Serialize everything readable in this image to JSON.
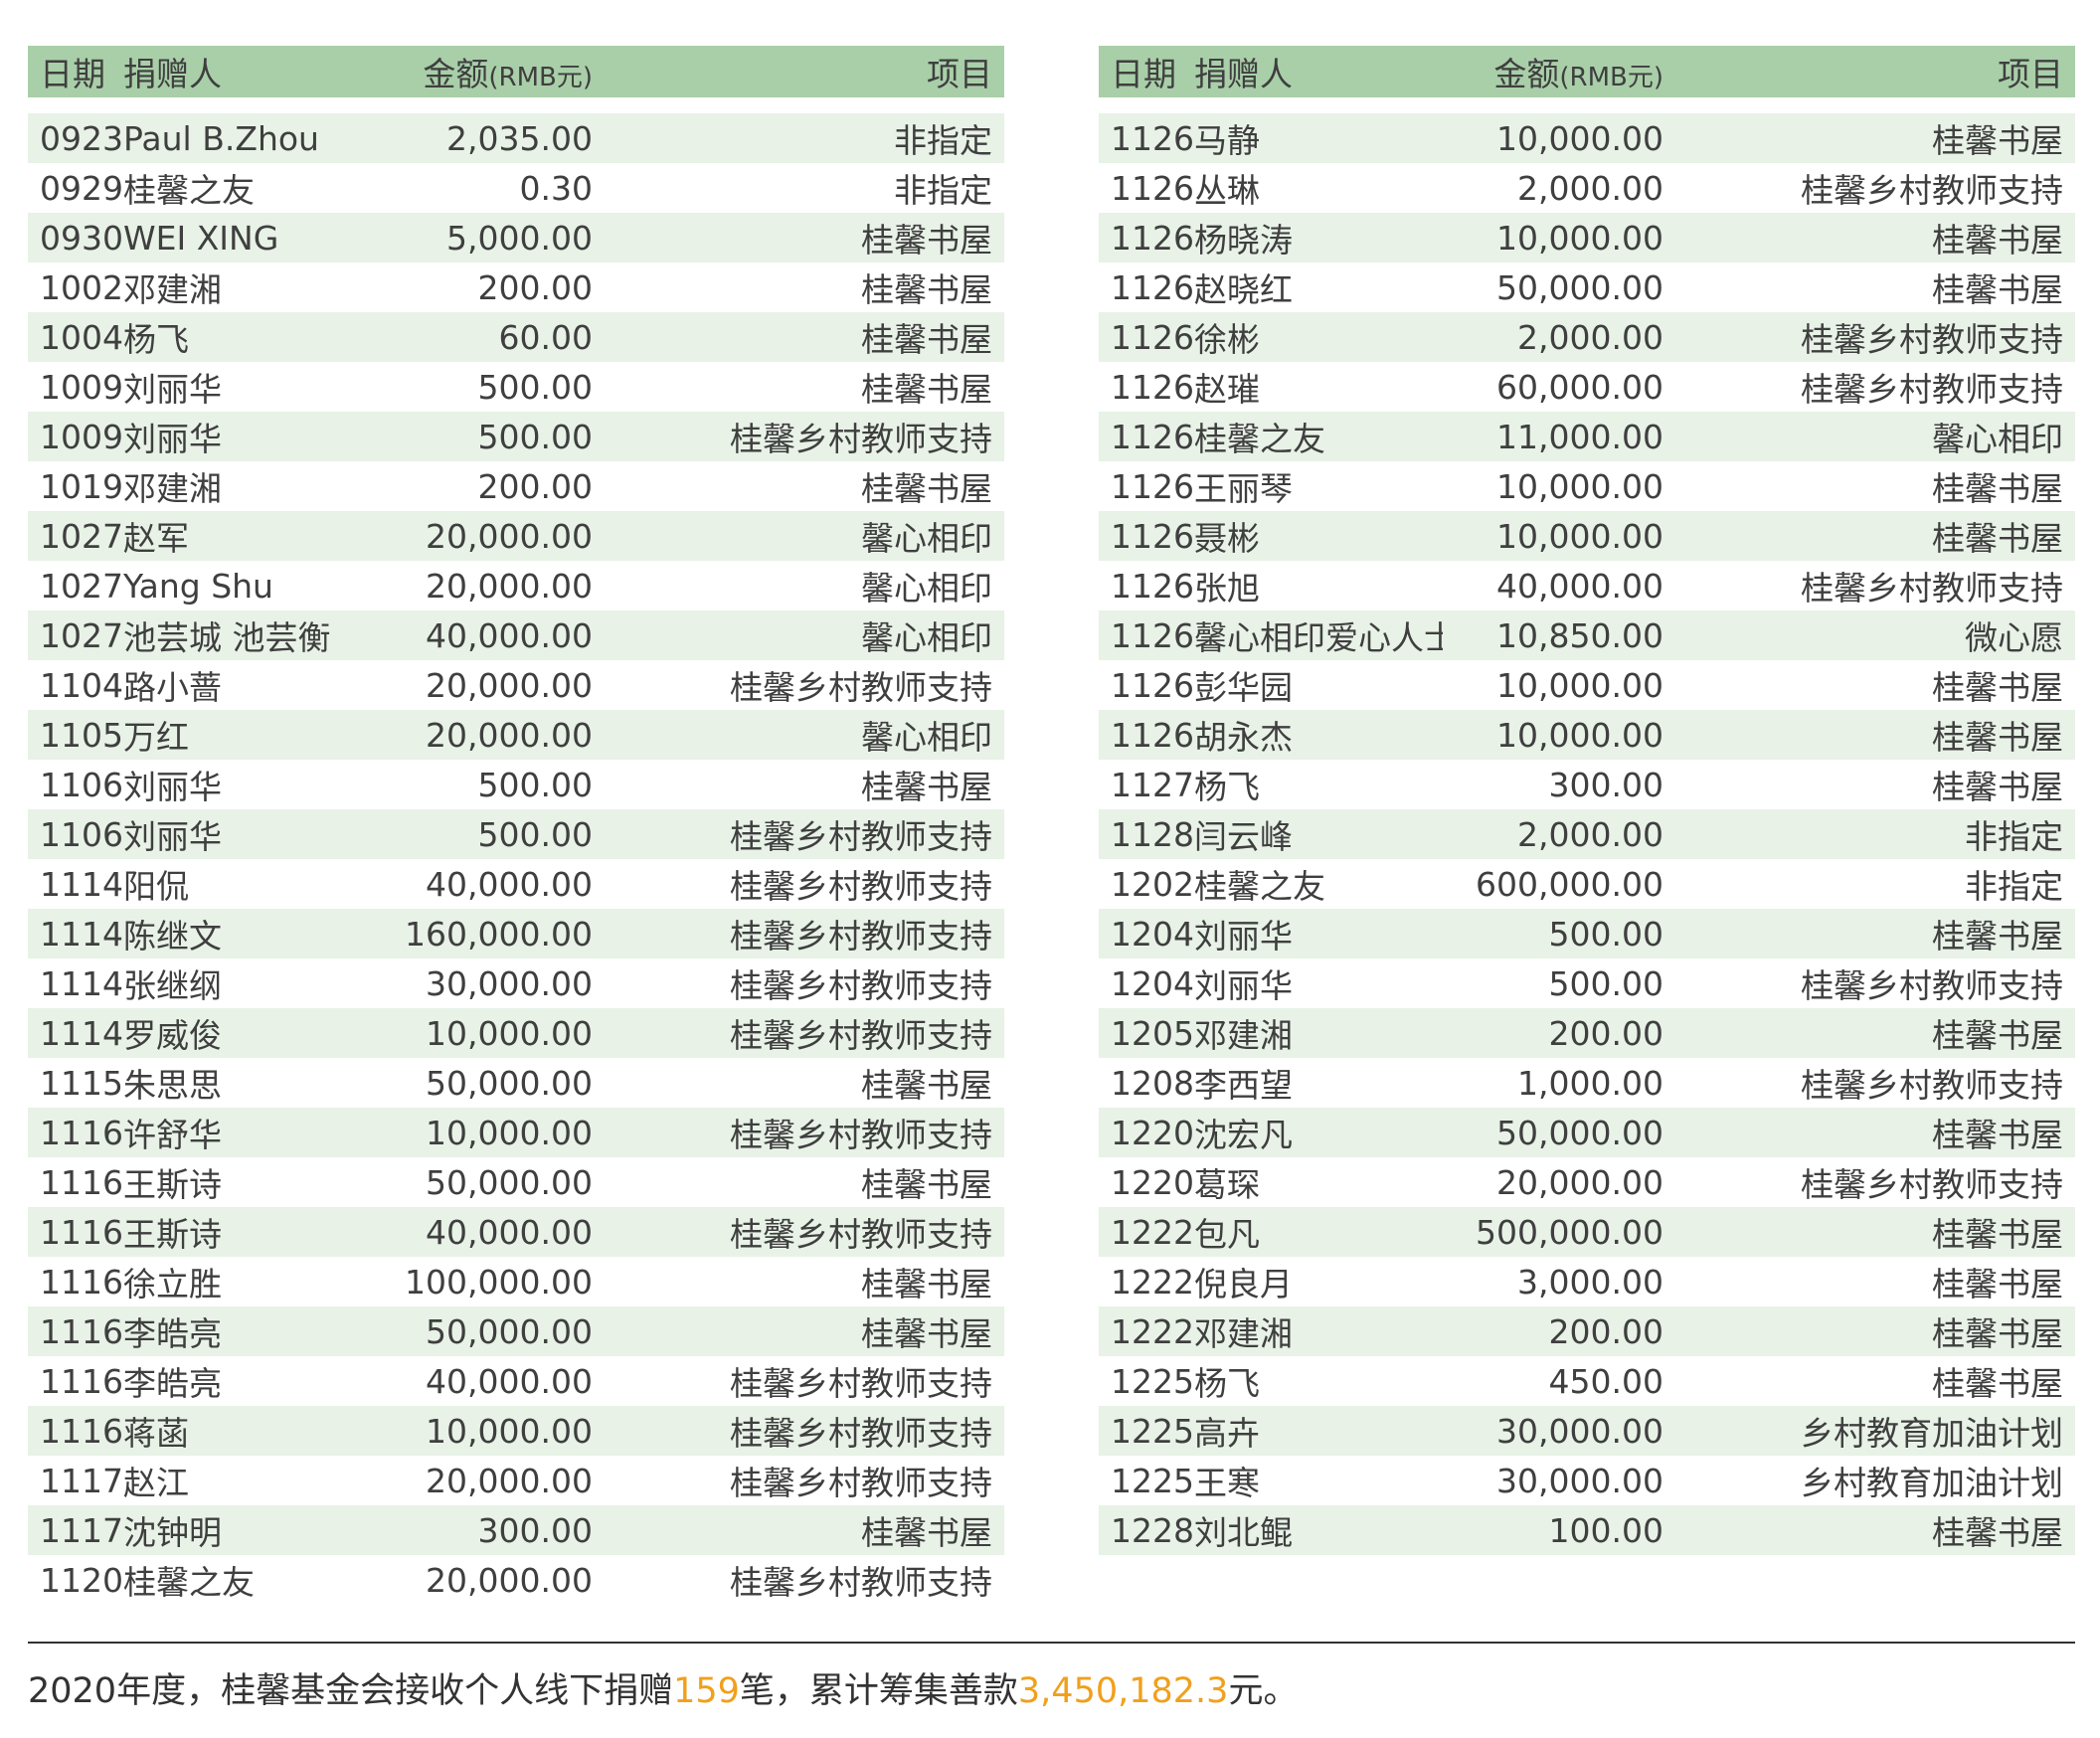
{
  "headers": {
    "date": "日期",
    "donor": "捐赠人",
    "amount": "金额",
    "amount_unit": "(RMB元)",
    "project": "项目"
  },
  "left_rows": [
    {
      "date": "0923",
      "donor": "Paul B.Zhou",
      "amount": "2,035.00",
      "project": "非指定"
    },
    {
      "date": "0929",
      "donor": "桂馨之友",
      "amount": "0.30",
      "project": "非指定"
    },
    {
      "date": "0930",
      "donor": "WEI XING",
      "amount": "5,000.00",
      "project": "桂馨书屋"
    },
    {
      "date": "1002",
      "donor": "邓建湘",
      "amount": "200.00",
      "project": "桂馨书屋"
    },
    {
      "date": "1004",
      "donor": "杨飞",
      "amount": "60.00",
      "project": "桂馨书屋"
    },
    {
      "date": "1009",
      "donor": "刘丽华",
      "amount": "500.00",
      "project": "桂馨书屋"
    },
    {
      "date": "1009",
      "donor": "刘丽华",
      "amount": "500.00",
      "project": "桂馨乡村教师支持"
    },
    {
      "date": "1019",
      "donor": "邓建湘",
      "amount": "200.00",
      "project": "桂馨书屋"
    },
    {
      "date": "1027",
      "donor": "赵军",
      "amount": "20,000.00",
      "project": "馨心相印"
    },
    {
      "date": "1027",
      "donor": "Yang Shu",
      "amount": "20,000.00",
      "project": "馨心相印"
    },
    {
      "date": "1027",
      "donor": "池芸城 池芸衡",
      "amount": "40,000.00",
      "project": "馨心相印"
    },
    {
      "date": "1104",
      "donor": "路小蔷",
      "amount": "20,000.00",
      "project": "桂馨乡村教师支持"
    },
    {
      "date": "1105",
      "donor": "万红",
      "amount": "20,000.00",
      "project": "馨心相印"
    },
    {
      "date": "1106",
      "donor": "刘丽华",
      "amount": "500.00",
      "project": "桂馨书屋"
    },
    {
      "date": "1106",
      "donor": "刘丽华",
      "amount": "500.00",
      "project": "桂馨乡村教师支持"
    },
    {
      "date": "1114",
      "donor": "阳侃",
      "amount": "40,000.00",
      "project": "桂馨乡村教师支持"
    },
    {
      "date": "1114",
      "donor": "陈继文",
      "amount": "160,000.00",
      "project": "桂馨乡村教师支持"
    },
    {
      "date": "1114",
      "donor": "张继纲",
      "amount": "30,000.00",
      "project": "桂馨乡村教师支持"
    },
    {
      "date": "1114",
      "donor": "罗威俊",
      "amount": "10,000.00",
      "project": "桂馨乡村教师支持"
    },
    {
      "date": "1115",
      "donor": "朱思思",
      "amount": "50,000.00",
      "project": "桂馨书屋"
    },
    {
      "date": "1116",
      "donor": "许舒华",
      "amount": "10,000.00",
      "project": "桂馨乡村教师支持"
    },
    {
      "date": "1116",
      "donor": "王斯诗",
      "amount": "50,000.00",
      "project": "桂馨书屋"
    },
    {
      "date": "1116",
      "donor": "王斯诗",
      "amount": "40,000.00",
      "project": "桂馨乡村教师支持"
    },
    {
      "date": "1116",
      "donor": "徐立胜",
      "amount": "100,000.00",
      "project": "桂馨书屋"
    },
    {
      "date": "1116",
      "donor": "李皓亮",
      "amount": "50,000.00",
      "project": "桂馨书屋"
    },
    {
      "date": "1116",
      "donor": "李皓亮",
      "amount": "40,000.00",
      "project": "桂馨乡村教师支持"
    },
    {
      "date": "1116",
      "donor": "蒋菡",
      "amount": "10,000.00",
      "project": "桂馨乡村教师支持"
    },
    {
      "date": "1117",
      "donor": "赵江",
      "amount": "20,000.00",
      "project": "桂馨乡村教师支持"
    },
    {
      "date": "1117",
      "donor": "沈钟明",
      "amount": "300.00",
      "project": "桂馨书屋"
    },
    {
      "date": "1120",
      "donor": "桂馨之友",
      "amount": "20,000.00",
      "project": "桂馨乡村教师支持"
    }
  ],
  "right_rows": [
    {
      "date": "1126",
      "donor": "马静",
      "amount": "10,000.00",
      "project": "桂馨书屋"
    },
    {
      "date": "1126",
      "donor": "丛琳",
      "amount": "2,000.00",
      "project": "桂馨乡村教师支持"
    },
    {
      "date": "1126",
      "donor": "杨晓涛",
      "amount": "10,000.00",
      "project": "桂馨书屋"
    },
    {
      "date": "1126",
      "donor": "赵晓红",
      "amount": "50,000.00",
      "project": "桂馨书屋"
    },
    {
      "date": "1126",
      "donor": "徐彬",
      "amount": "2,000.00",
      "project": "桂馨乡村教师支持"
    },
    {
      "date": "1126",
      "donor": "赵璀",
      "amount": "60,000.00",
      "project": "桂馨乡村教师支持"
    },
    {
      "date": "1126",
      "donor": "桂馨之友",
      "amount": "11,000.00",
      "project": "馨心相印"
    },
    {
      "date": "1126",
      "donor": "王丽琴",
      "amount": "10,000.00",
      "project": "桂馨书屋"
    },
    {
      "date": "1126",
      "donor": "聂彬",
      "amount": "10,000.00",
      "project": "桂馨书屋"
    },
    {
      "date": "1126",
      "donor": "张旭",
      "amount": "40,000.00",
      "project": "桂馨乡村教师支持"
    },
    {
      "date": "1126",
      "donor": "馨心相印爱心人士",
      "amount": "10,850.00",
      "project": "微心愿"
    },
    {
      "date": "1126",
      "donor": "彭华园",
      "amount": "10,000.00",
      "project": "桂馨书屋"
    },
    {
      "date": "1126",
      "donor": "胡永杰",
      "amount": "10,000.00",
      "project": "桂馨书屋"
    },
    {
      "date": "1127",
      "donor": "杨飞",
      "amount": "300.00",
      "project": "桂馨书屋"
    },
    {
      "date": "1128",
      "donor": "闫云峰",
      "amount": "2,000.00",
      "project": "非指定"
    },
    {
      "date": "1202",
      "donor": "桂馨之友",
      "amount": "600,000.00",
      "project": "非指定"
    },
    {
      "date": "1204",
      "donor": "刘丽华",
      "amount": "500.00",
      "project": "桂馨书屋"
    },
    {
      "date": "1204",
      "donor": "刘丽华",
      "amount": "500.00",
      "project": "桂馨乡村教师支持"
    },
    {
      "date": "1205",
      "donor": "邓建湘",
      "amount": "200.00",
      "project": "桂馨书屋"
    },
    {
      "date": "1208",
      "donor": "李西望",
      "amount": "1,000.00",
      "project": "桂馨乡村教师支持"
    },
    {
      "date": "1220",
      "donor": "沈宏凡",
      "amount": "50,000.00",
      "project": "桂馨书屋"
    },
    {
      "date": "1220",
      "donor": "葛琛",
      "amount": "20,000.00",
      "project": "桂馨乡村教师支持"
    },
    {
      "date": "1222",
      "donor": "包凡",
      "amount": "500,000.00",
      "project": "桂馨书屋"
    },
    {
      "date": "1222",
      "donor": "倪良月",
      "amount": "3,000.00",
      "project": "桂馨书屋"
    },
    {
      "date": "1222",
      "donor": "邓建湘",
      "amount": "200.00",
      "project": "桂馨书屋"
    },
    {
      "date": "1225",
      "donor": "杨飞",
      "amount": "450.00",
      "project": "桂馨书屋"
    },
    {
      "date": "1225",
      "donor": "高卉",
      "amount": "30,000.00",
      "project": "乡村教育加油计划"
    },
    {
      "date": "1225",
      "donor": "王寒",
      "amount": "30,000.00",
      "project": "乡村教育加油计划"
    },
    {
      "date": "1228",
      "donor": "刘北鲲",
      "amount": "100.00",
      "project": "桂馨书屋"
    }
  ],
  "footer": {
    "part1": "2020年度，桂馨基金会接收个人线下捐赠",
    "count": "159",
    "part2": "笔，累计筹集善款",
    "total": "3,450,182.3",
    "part3": "元。"
  },
  "colors": {
    "header_bg": "#a9cfa9",
    "stripe_bg": "#e8f2e7",
    "highlight": "#f0a01c"
  }
}
